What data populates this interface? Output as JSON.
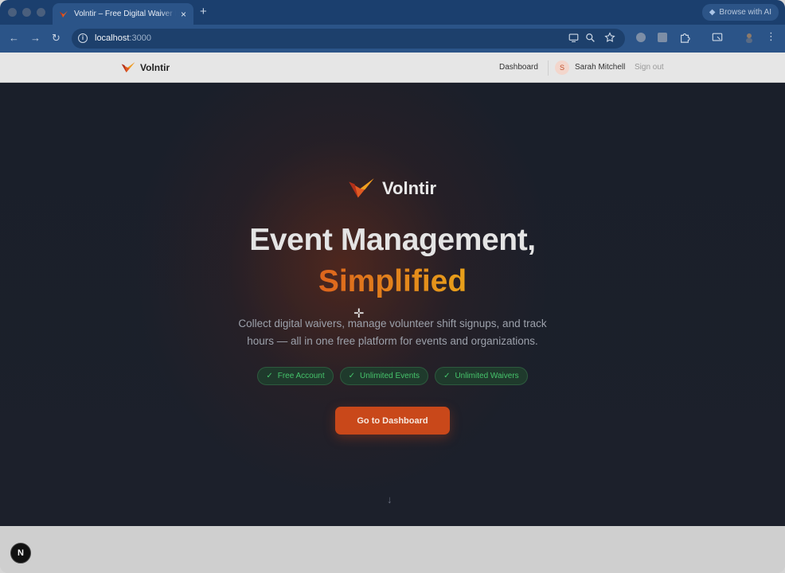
{
  "browser": {
    "tab_title": "Volntir – Free Digital Waiver M",
    "tab_close": "×",
    "new_tab": "+",
    "browse_ai_label": "Browse with AI",
    "url_host": "localhost",
    "url_port": ":3000",
    "nav_back": "←",
    "nav_forward": "→",
    "nav_reload": "↻"
  },
  "site_nav": {
    "brand": "Volntir",
    "dashboard_link": "Dashboard",
    "avatar_initial": "S",
    "user_name": "Sarah Mitchell",
    "sign_out": "Sign out"
  },
  "hero": {
    "logo_text": "Volntir",
    "headline": "Event Management,",
    "headline_accent": "Simplified",
    "subtitle": "Collect digital waivers, manage volunteer shift signups, and track hours — all in one free platform for events and organizations.",
    "badges": [
      "Free Account",
      "Unlimited Events",
      "Unlimited Waivers"
    ],
    "badge_check": "✓",
    "cta_label": "Go to Dashboard",
    "scroll_arrow": "↓",
    "cursor": "✛"
  },
  "devtools": {
    "next_badge": "N"
  },
  "colors": {
    "brand_orange": "#d9521e",
    "accent_amber": "#e8a21a",
    "badge_green": "#46c46b",
    "browser_blue": "#2b5488"
  },
  "icons": {
    "tab_favicon": "volntir-logo-icon",
    "omnibox_info": "info-icon",
    "zoom": "zoom-icon",
    "bookmark": "star-icon",
    "cast": "cast-icon",
    "extensions": "puzzle-icon",
    "menu": "kebab-menu-icon"
  }
}
